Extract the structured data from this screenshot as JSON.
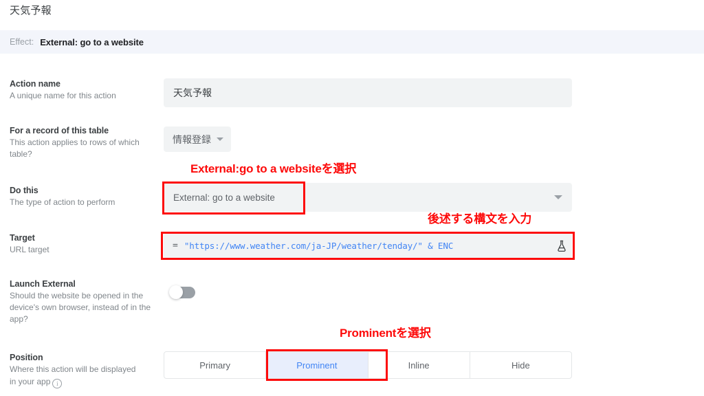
{
  "header": {
    "title": "天気予報",
    "effect_label": "Effect:",
    "effect_value": "External: go to a website"
  },
  "fields": {
    "action_name": {
      "label": "Action name",
      "description": "A unique name for this action",
      "value": "天気予報"
    },
    "table": {
      "label": "For a record of this table",
      "description": "This action applies to rows of which table?",
      "value": "情報登録"
    },
    "do_this": {
      "label": "Do this",
      "description": "The type of action to perform",
      "value": "External: go to a website"
    },
    "target": {
      "label": "Target",
      "description": "URL target",
      "equals_sign": "=",
      "formula": "\"https://www.weather.com/ja-JP/weather/tenday/\" & ENC",
      "icon": "flask-icon"
    },
    "launch_external": {
      "label": "Launch External",
      "description": "Should the website be opened in the device's own browser, instead of in the app?",
      "toggle_state": "off"
    },
    "position": {
      "label": "Position",
      "description_line1": "Where this action will be displayed",
      "description_line2": "in your app",
      "info_icon": "info-icon",
      "options": [
        "Primary",
        "Prominent",
        "Inline",
        "Hide"
      ],
      "selected": "Prominent"
    }
  },
  "annotations": [
    {
      "text": "External:go to a websiteを選択"
    },
    {
      "text": "後述する構文を入力"
    },
    {
      "text": "Prominentを選択"
    }
  ],
  "colors": {
    "annotation_red": "#fd0a0a",
    "accent_blue": "#4285f4",
    "field_gray": "#f1f3f4",
    "banner": "#f3f5fb"
  }
}
